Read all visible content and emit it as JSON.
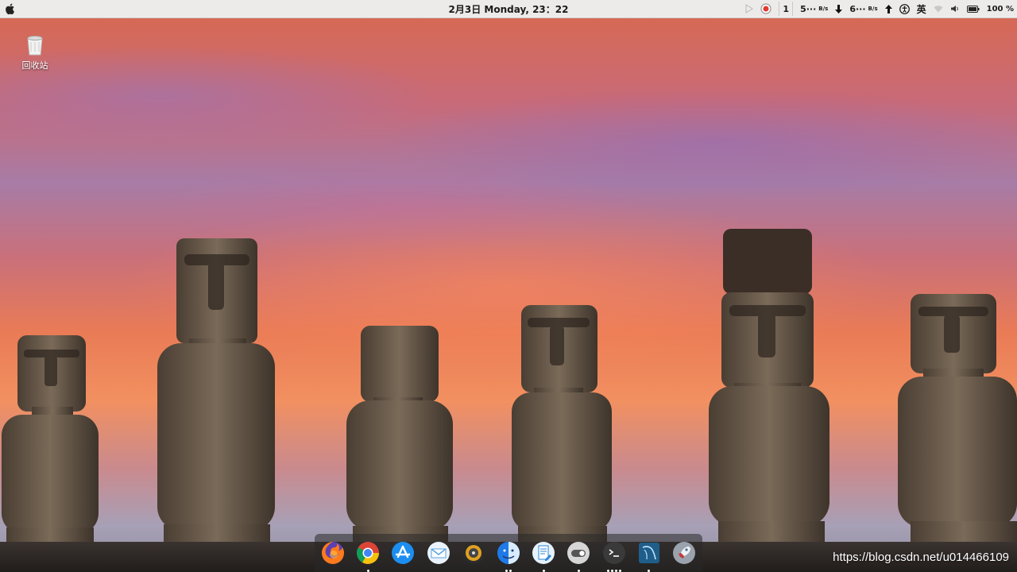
{
  "menubar": {
    "clock": "2月3日 Monday, 23：22",
    "tray": {
      "indicator_num": "1",
      "upload_speed": "5···",
      "upload_unit": "B/s",
      "download_speed": "6···",
      "download_unit": "B/s",
      "ime": "英",
      "battery": "100 %"
    }
  },
  "desktop": {
    "trash_label": "回收站"
  },
  "dock": {
    "items": [
      {
        "name": "firefox",
        "running": 0
      },
      {
        "name": "chrome",
        "running": 1
      },
      {
        "name": "app-store",
        "running": 0
      },
      {
        "name": "mail",
        "running": 0
      },
      {
        "name": "music-player",
        "running": 0
      },
      {
        "name": "finder",
        "running": 2
      },
      {
        "name": "text-editor",
        "running": 1
      },
      {
        "name": "toggle-settings",
        "running": 1
      },
      {
        "name": "terminal",
        "running": 4
      },
      {
        "name": "database-tool",
        "running": 1
      },
      {
        "name": "launchpad",
        "running": 0
      }
    ]
  },
  "watermark": "https://blog.csdn.net/u014466109"
}
